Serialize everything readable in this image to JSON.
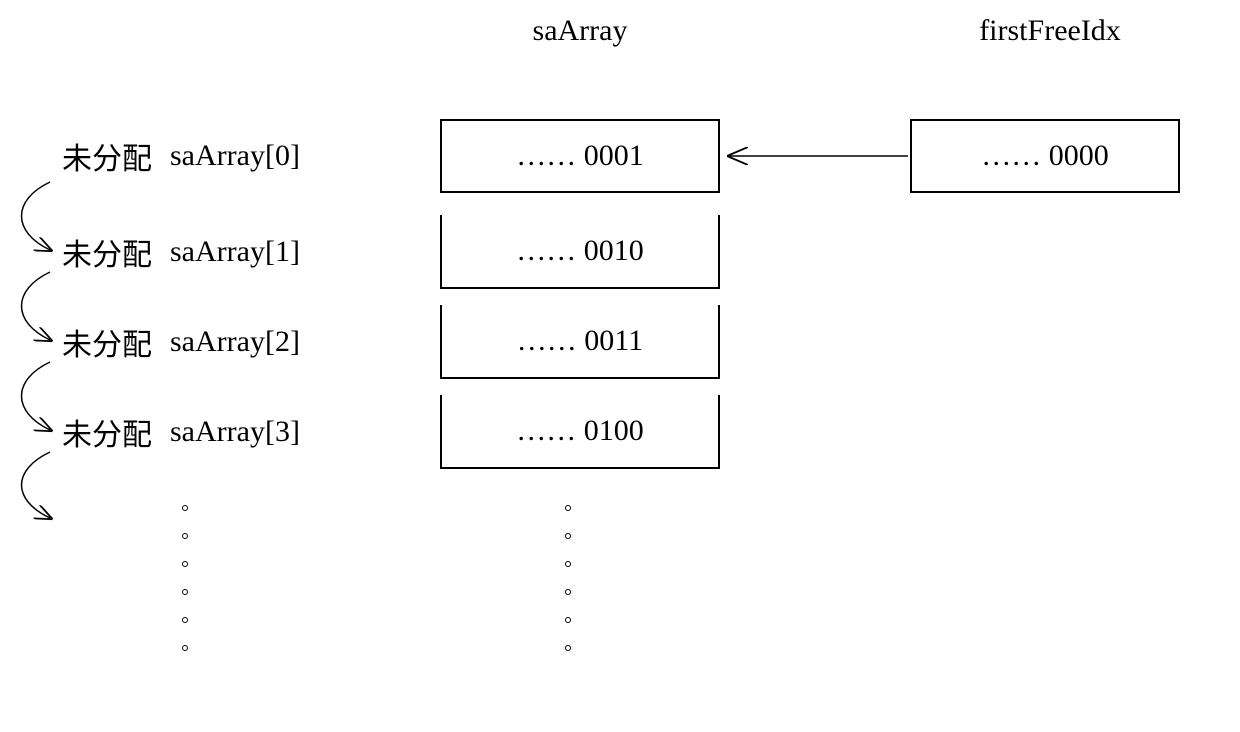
{
  "title_sa": "saArray",
  "title_ff": "firstFreeIdx",
  "rows": [
    {
      "status": "未分配",
      "label": "saArray[0]",
      "value": "……  0001"
    },
    {
      "status": "未分配",
      "label": "saArray[1]",
      "value": "……  0010"
    },
    {
      "status": "未分配",
      "label": "saArray[2]",
      "value": "……  0011"
    },
    {
      "status": "未分配",
      "label": "saArray[3]",
      "value": "……  0100"
    }
  ],
  "ff_value": "……  0000"
}
